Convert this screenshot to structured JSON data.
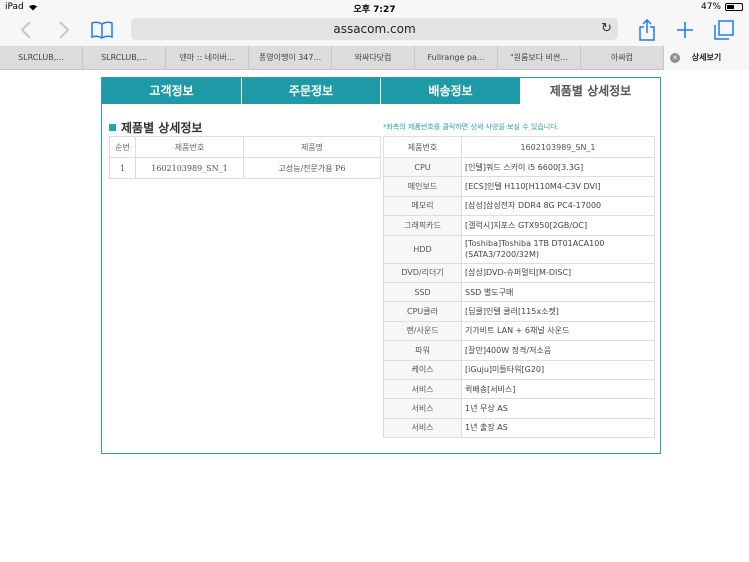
{
  "status": {
    "device": "iPad",
    "time": "오후 7:27",
    "battery": "47%",
    "battery_level": 0.47
  },
  "browser": {
    "url": "assacom.com"
  },
  "tabs": [
    {
      "label": "SLRCLUB,..."
    },
    {
      "label": "SLRCLUB,..."
    },
    {
      "label": "덴마 :: 네이버..."
    },
    {
      "label": "퐁영이땡이 347..."
    },
    {
      "label": "와싸다닷컴"
    },
    {
      "label": "Fullrange pa..."
    },
    {
      "label": "\"원룸보다 비싼..."
    },
    {
      "label": "아싸컴"
    },
    {
      "label": "상세보기"
    }
  ],
  "page_tabs": [
    "고객정보",
    "주문정보",
    "배송정보",
    "제품별 상세정보"
  ],
  "section_title": "제품별 상세정보",
  "hint": "*좌측의 제품번호를 클릭하면 상세 사양을 보실 수 있습니다.",
  "left_table": {
    "headers": [
      "순번",
      "제품번호",
      "제품명"
    ],
    "rows": [
      [
        "1",
        "1602103989_SN_1",
        "고성능/전문가용 P6"
      ]
    ]
  },
  "right_table": {
    "headers": [
      "제품번호",
      "1602103989_SN_1"
    ],
    "rows": [
      [
        "CPU",
        "[인텔]쿼드 스카이 i5 6600[3.3G]"
      ],
      [
        "메인보드",
        "[ECS]인텔 H110[H110M4-C3V DVI]"
      ],
      [
        "메모리",
        "[삼성]삼성전자 DDR4 8G PC4-17000"
      ],
      [
        "그래픽카드",
        "[갤럭시]지포스 GTX950[2GB/OC]"
      ],
      [
        "HDD",
        "[Toshiba]Toshiba 1TB DT01ACA100 (SATA3/7200/32M)"
      ],
      [
        "DVD/리더기",
        "[삼성]DVD-슈퍼멀티[M-DISC]"
      ],
      [
        "SSD",
        "SSD 별도구매"
      ],
      [
        "CPU쿨러",
        "[딥쿨]인텔 쿨러[115x소켓]"
      ],
      [
        "랜/사운드",
        "기가비트 LAN + 6채널 사운드"
      ],
      [
        "파워",
        "[잘만]400W 정격/저소음"
      ],
      [
        "케이스",
        "[iGuju]미들타워[G20]"
      ],
      [
        "서비스",
        "퀵배송[서비스]"
      ],
      [
        "서비스",
        "1년 무상 AS"
      ],
      [
        "서비스",
        "1년 출장 AS"
      ]
    ]
  },
  "colors": {
    "accent": "#1d9aa5",
    "link": "#1a7cf6"
  }
}
